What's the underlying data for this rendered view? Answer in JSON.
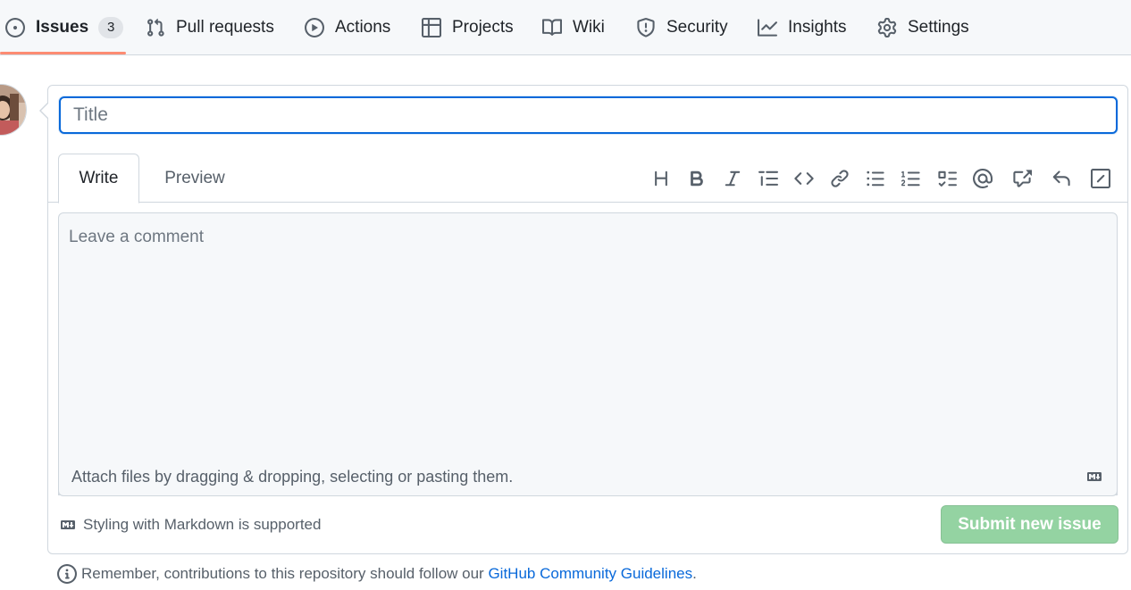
{
  "nav": {
    "tabs": [
      {
        "label": "Issues",
        "icon": "issue-opened-icon",
        "counter": "3",
        "selected": true
      },
      {
        "label": "Pull requests",
        "icon": "git-pull-request-icon"
      },
      {
        "label": "Actions",
        "icon": "play-icon"
      },
      {
        "label": "Projects",
        "icon": "table-icon"
      },
      {
        "label": "Wiki",
        "icon": "book-icon"
      },
      {
        "label": "Security",
        "icon": "shield-icon"
      },
      {
        "label": "Insights",
        "icon": "graph-icon"
      },
      {
        "label": "Settings",
        "icon": "gear-icon"
      }
    ],
    "underline_color": "#fd8c73"
  },
  "form": {
    "title_placeholder": "Title",
    "title_value": "",
    "tabs": {
      "write": "Write",
      "preview": "Preview"
    },
    "toolbar": [
      "heading-icon",
      "bold-icon",
      "italic-icon",
      "quote-icon",
      "code-icon",
      "link-icon",
      "unordered-list-icon",
      "ordered-list-icon",
      "task-list-icon",
      "mention-icon",
      "cross-reference-icon",
      "saved-reply-icon",
      "slash-command-icon"
    ],
    "comment_placeholder": "Leave a comment",
    "attach_text": "Attach files by dragging & dropping, selecting or pasting them.",
    "markdown_note": "Styling with Markdown is supported",
    "submit_label": "Submit new issue",
    "submit_color": "#94d3a2"
  },
  "guidelines": {
    "prefix": "Remember, contributions to this repository should follow our ",
    "link": "GitHub Community Guidelines",
    "suffix": "."
  },
  "colors": {
    "accent": "#0969da",
    "border": "#d0d7de",
    "muted": "#57606a"
  }
}
